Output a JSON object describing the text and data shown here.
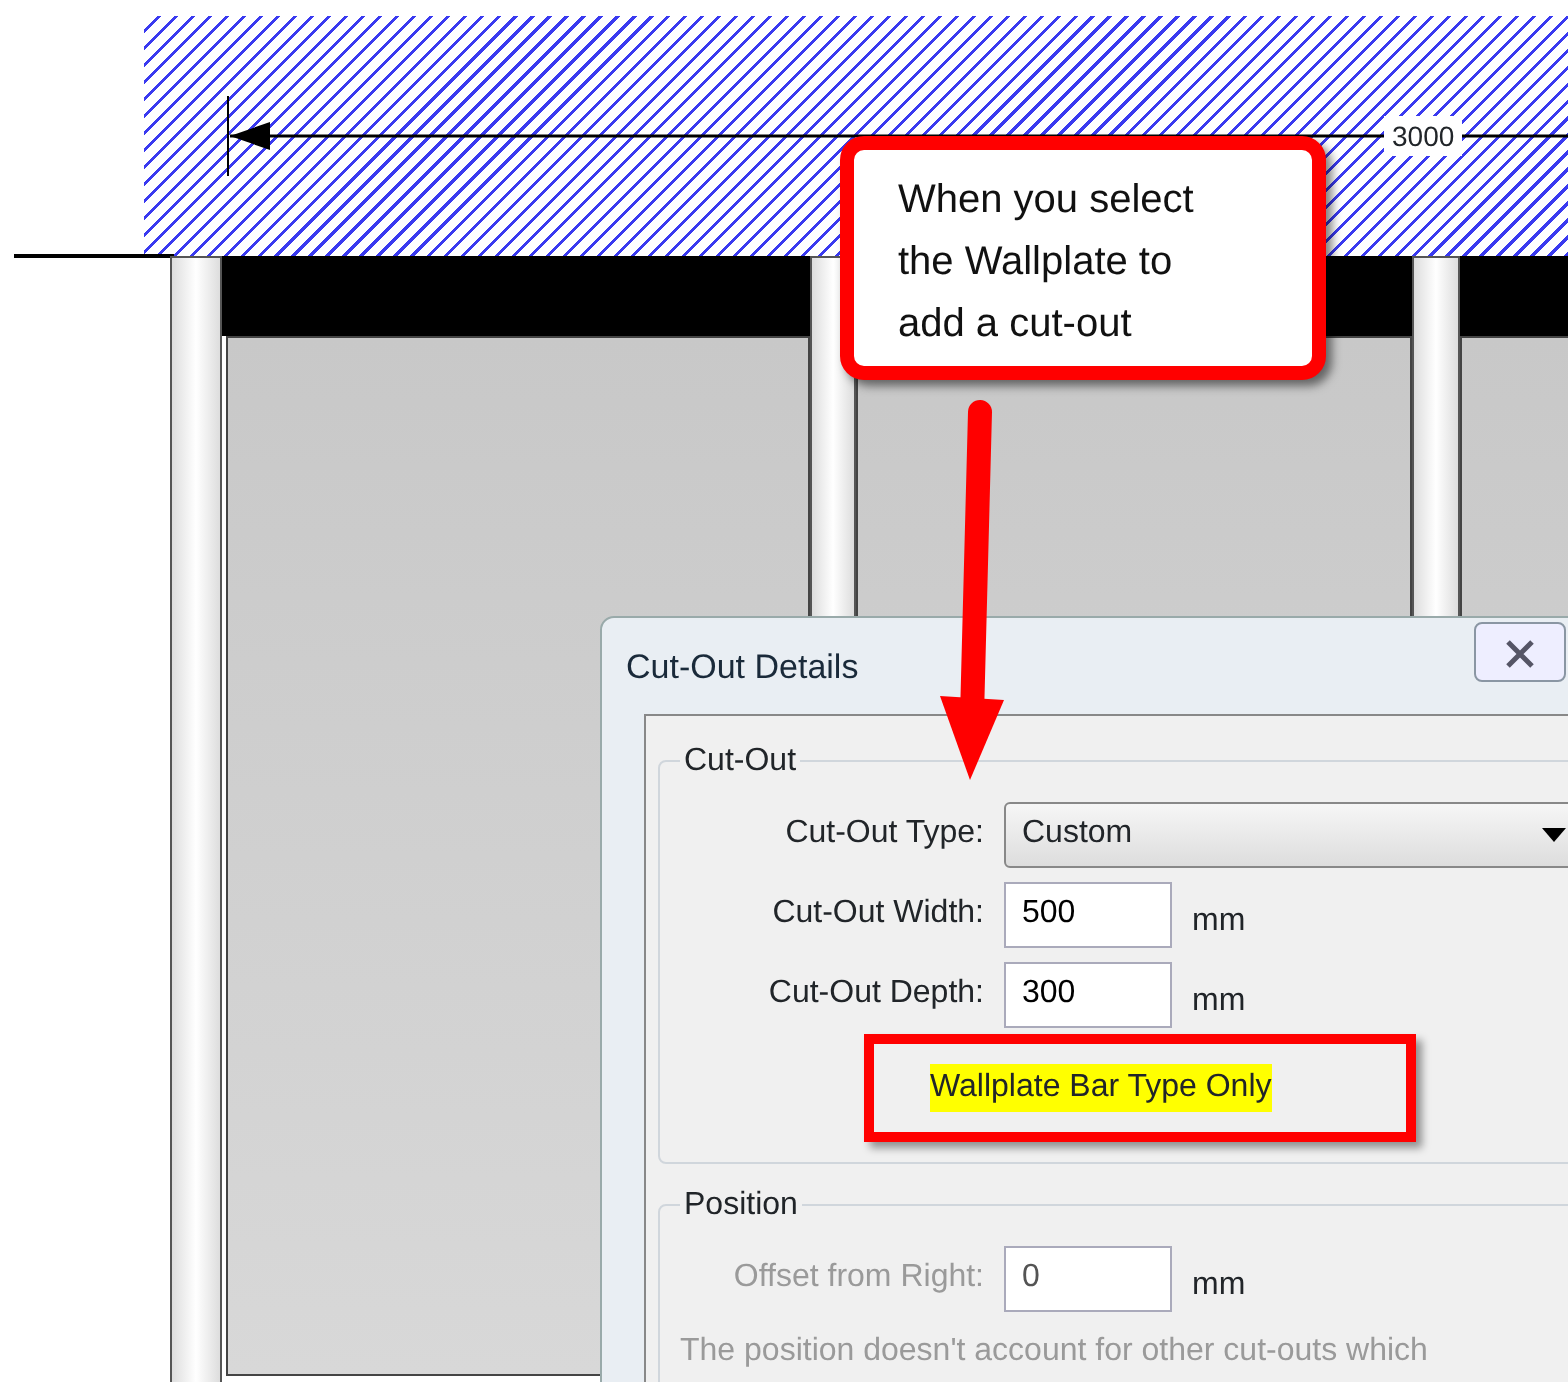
{
  "drawing": {
    "dimension": "3000"
  },
  "callout": {
    "text": "When you select the Wallplate to add a cut-out"
  },
  "dialog": {
    "title": "Cut-Out Details",
    "groups": [
      {
        "legend": "Cut-Out",
        "fields": [
          {
            "kind": "select",
            "label": "Cut-Out Type:",
            "value": "Custom",
            "disabled": false
          },
          {
            "kind": "input",
            "label": "Cut-Out Width:",
            "value": "500",
            "unit": "mm",
            "disabled": false
          },
          {
            "kind": "input",
            "label": "Cut-Out Depth:",
            "value": "300",
            "unit": "mm",
            "disabled": false
          }
        ],
        "note": {
          "text": "Wallplate Bar Type Only",
          "highlighted": true
        }
      },
      {
        "legend": "Position",
        "fields": [
          {
            "kind": "input",
            "label": "Offset from Right:",
            "value": "0",
            "unit": "mm",
            "disabled": true
          }
        ],
        "note": {
          "text": "The position doesn't account for other cut-outs which",
          "disabled": true
        }
      }
    ]
  }
}
